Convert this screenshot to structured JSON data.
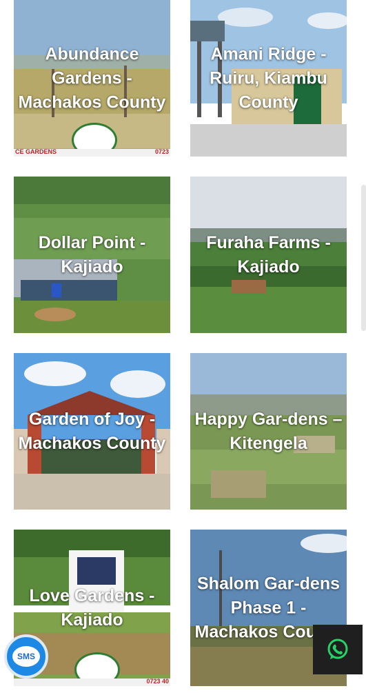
{
  "projects": [
    {
      "title": "Abundance Gardens - Machakos County",
      "strip_left": "CE GARDENS",
      "strip_right": "0723"
    },
    {
      "title": "Amani Ridge - Ruiru, Kiambu County"
    },
    {
      "title": "Dollar Point - Kajiado"
    },
    {
      "title": "Furaha Farms - Kajiado"
    },
    {
      "title": "Garden of Joy - Machakos County"
    },
    {
      "title": "Happy Gar-dens – Kitengela"
    },
    {
      "title": "Love Gardens - Kajiado",
      "strip_right": "0723 40"
    },
    {
      "title": "Shalom Gar-dens Phase 1 - Machakos County"
    }
  ],
  "floating": {
    "sms_label": "SMS",
    "whatsapp_icon": "whatsapp-icon"
  },
  "colors": {
    "sms_blue": "#1e88e5",
    "whatsapp_green": "#25d366",
    "card_text": "#ffffff"
  }
}
